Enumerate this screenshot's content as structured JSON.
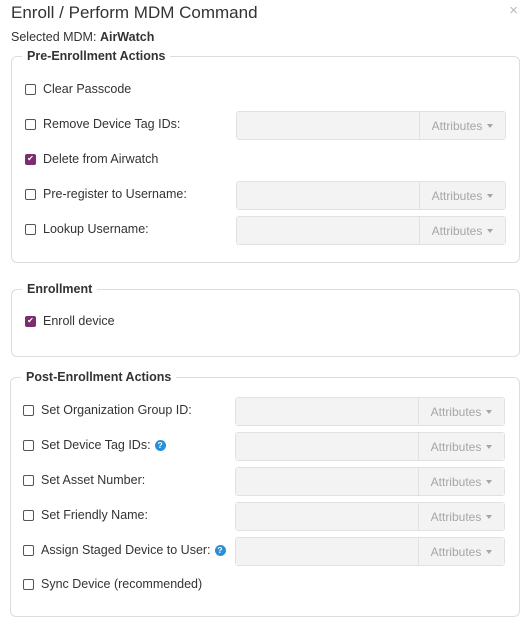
{
  "modal": {
    "title": "Enroll / Perform MDM Command",
    "close_icon": "close-icon",
    "selected_mdm_label": "Selected MDM:",
    "selected_mdm_value": "AirWatch"
  },
  "attributes_label": "Attributes",
  "pre_enrollment": {
    "legend": "Pre-Enrollment Actions",
    "items": [
      {
        "label": "Clear Passcode",
        "checked": false,
        "has_field": false
      },
      {
        "label": "Remove Device Tag IDs:",
        "checked": false,
        "has_field": true,
        "value": ""
      },
      {
        "label": "Delete from Airwatch",
        "checked": true,
        "has_field": false
      },
      {
        "label": "Pre-register to Username:",
        "checked": false,
        "has_field": true,
        "value": ""
      },
      {
        "label": "Lookup Username:",
        "checked": false,
        "has_field": true,
        "value": ""
      }
    ]
  },
  "enrollment": {
    "legend": "Enrollment",
    "items": [
      {
        "label": "Enroll device",
        "checked": true
      }
    ]
  },
  "post_enrollment": {
    "legend": "Post-Enrollment Actions",
    "items": [
      {
        "label": "Set Organization Group ID:",
        "checked": false,
        "has_field": true,
        "value": ""
      },
      {
        "label": "Set Device Tag IDs:",
        "checked": false,
        "has_field": true,
        "value": "",
        "help_icon": "question-circle-icon"
      },
      {
        "label": "Set Asset Number:",
        "checked": false,
        "has_field": true,
        "value": ""
      },
      {
        "label": "Set Friendly Name:",
        "checked": false,
        "has_field": true,
        "value": ""
      },
      {
        "label": "Assign Staged Device to User:",
        "checked": false,
        "has_field": true,
        "value": "",
        "help_icon": "question-circle-icon"
      },
      {
        "label": "Sync Device (recommended)",
        "checked": false,
        "has_field": false
      }
    ]
  },
  "colors": {
    "checkbox_checked": "#7b2d6d",
    "help_icon": "#2a8fd6",
    "field_bg": "#f3f3f3",
    "border": "#dddddd"
  }
}
